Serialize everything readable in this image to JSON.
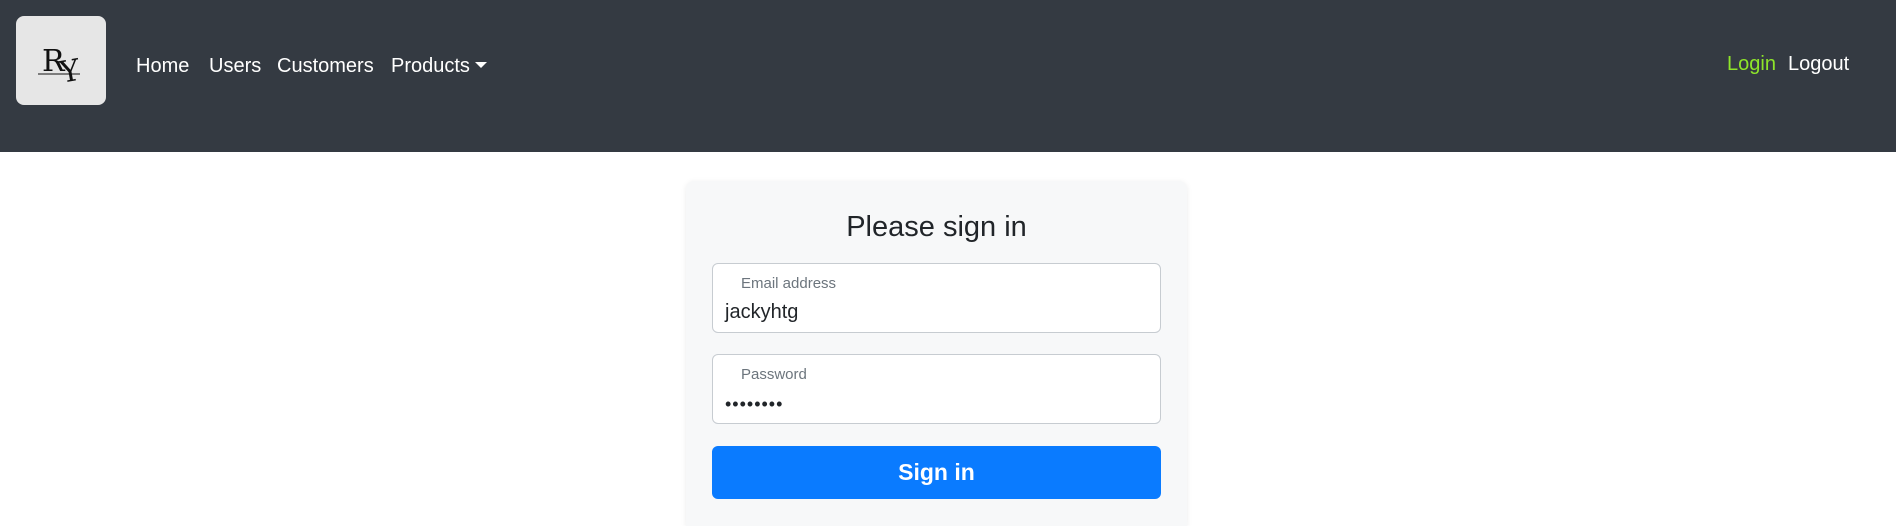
{
  "navbar": {
    "logo_alt": "RY logo",
    "links": {
      "home": "Home",
      "users": "Users",
      "customers": "Customers",
      "products": "Products"
    },
    "login": "Login",
    "logout": "Logout",
    "login_color": "#8ee52a"
  },
  "form": {
    "title": "Please sign in",
    "email": {
      "label": "Email address",
      "value": "jackyhtg"
    },
    "password": {
      "label": "Password",
      "masked_value": "••••••••"
    },
    "submit_label": "Sign in"
  }
}
